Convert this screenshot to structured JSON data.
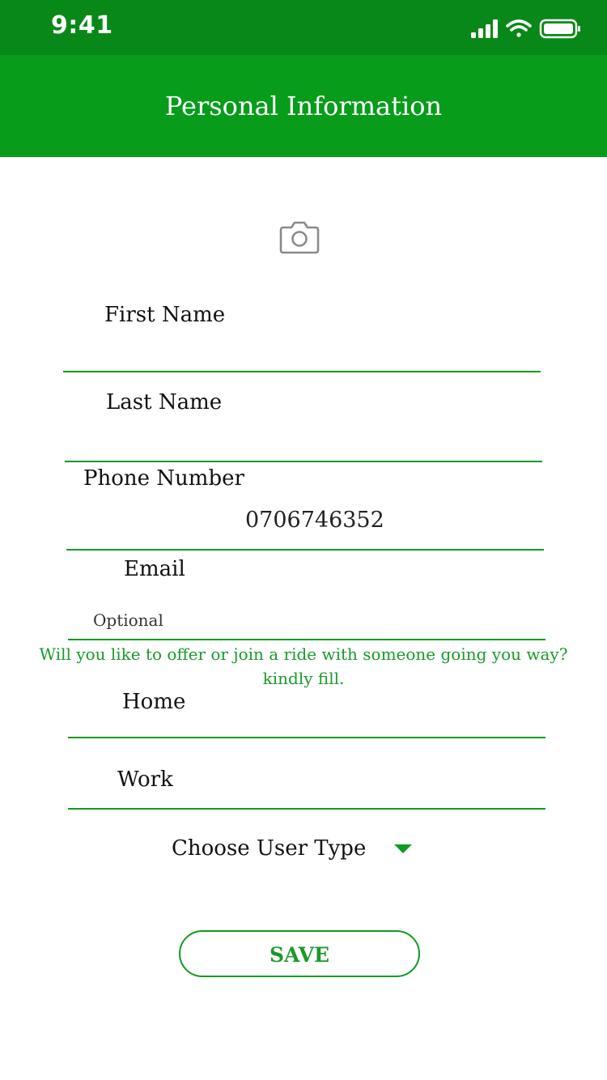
{
  "status_bar": {
    "time": "9:41",
    "icons": [
      "signal-icon",
      "wifi-icon",
      "battery-icon"
    ]
  },
  "header": {
    "title": "Personal Information"
  },
  "photo": {
    "icon": "camera-icon"
  },
  "form": {
    "first_name": {
      "label": "First Name",
      "value": ""
    },
    "last_name": {
      "label": "Last Name",
      "value": ""
    },
    "phone": {
      "label": "Phone Number",
      "value": "0706746352"
    },
    "email": {
      "label": "Email",
      "hint": "Optional",
      "value": ""
    },
    "ride_note": {
      "line1": "Will you like to offer or join a ride with someone going you way?",
      "line2": "kindly fill."
    },
    "home": {
      "label": "Home",
      "value": ""
    },
    "work": {
      "label": "Work",
      "value": ""
    },
    "user_type": {
      "label": "Choose User Type"
    }
  },
  "actions": {
    "save_label": "SAVE"
  },
  "colors": {
    "status_bar": "#088818",
    "header": "#079c1a",
    "accent": "#119a22",
    "note_text": "#1a9a2a"
  }
}
